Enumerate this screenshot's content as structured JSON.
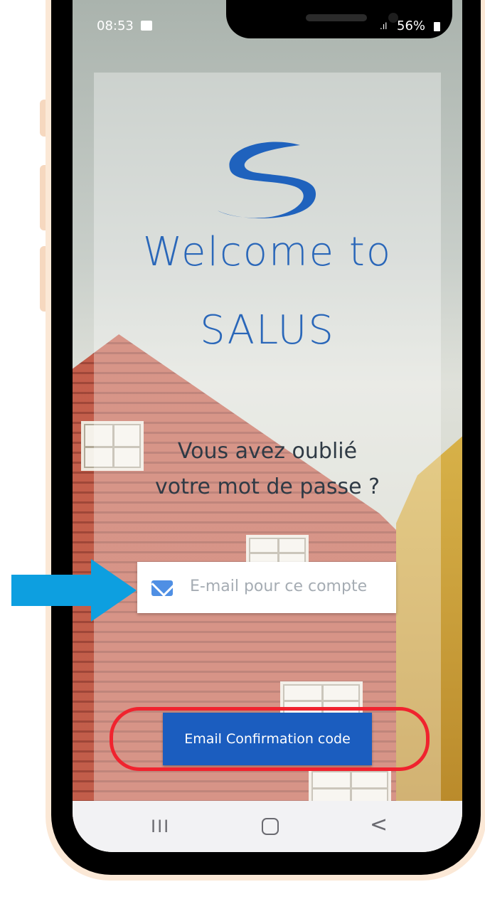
{
  "status_bar": {
    "time": "08:53",
    "signal": ".ıl",
    "battery": "56%"
  },
  "app": {
    "logo": "salus-logo-icon",
    "welcome_line1": "Welcome to",
    "welcome_line2": "SALUS",
    "forgot_line1": "Vous avez oublié",
    "forgot_line2": "votre mot de passe ?"
  },
  "form": {
    "email_placeholder": "E-mail pour ce compte",
    "email_value": "",
    "submit_label": "Email Confirmation code"
  },
  "nav": {
    "recents": "III",
    "back": "<"
  },
  "colors": {
    "brand_blue": "#2a67b9",
    "button_blue": "#1b5dbf",
    "highlight_red": "#f0232e",
    "arrow_blue": "#0d9fe0"
  }
}
